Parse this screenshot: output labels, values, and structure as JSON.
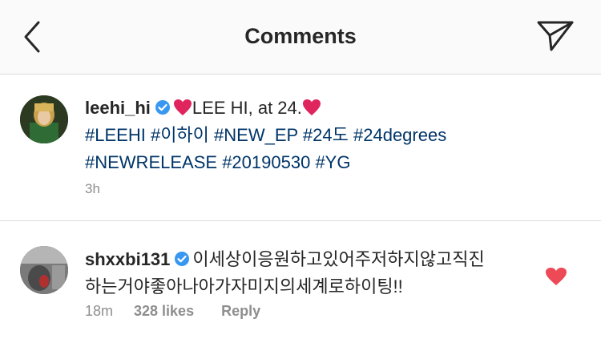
{
  "header": {
    "title": "Comments"
  },
  "post": {
    "username": "leehi_hi",
    "caption_text": "LEE HI, at 24.",
    "hashtags_line1": [
      "#LEEHI",
      "#이하이",
      "#NEW_EP",
      "#24도",
      "#24degrees"
    ],
    "hashtags_line2": [
      "#NEWRELEASE",
      "#20190530",
      "#YG"
    ],
    "time": "3h"
  },
  "comment": {
    "username": "shxxbi131",
    "text_line1": "이세상이응원하고있어주저하지않고직진",
    "text_line2": "하는거야좋아나아가자미지의세계로하이팅!!",
    "time": "18m",
    "likes": "328 likes",
    "reply_label": "Reply"
  },
  "colors": {
    "verified": "#3897f0",
    "heart": "#ed4956",
    "hashtag": "#003569",
    "muted": "#8e8e8e"
  },
  "icons": {
    "back": "chevron-left-icon",
    "share": "paper-plane-icon",
    "like": "heart-icon"
  }
}
